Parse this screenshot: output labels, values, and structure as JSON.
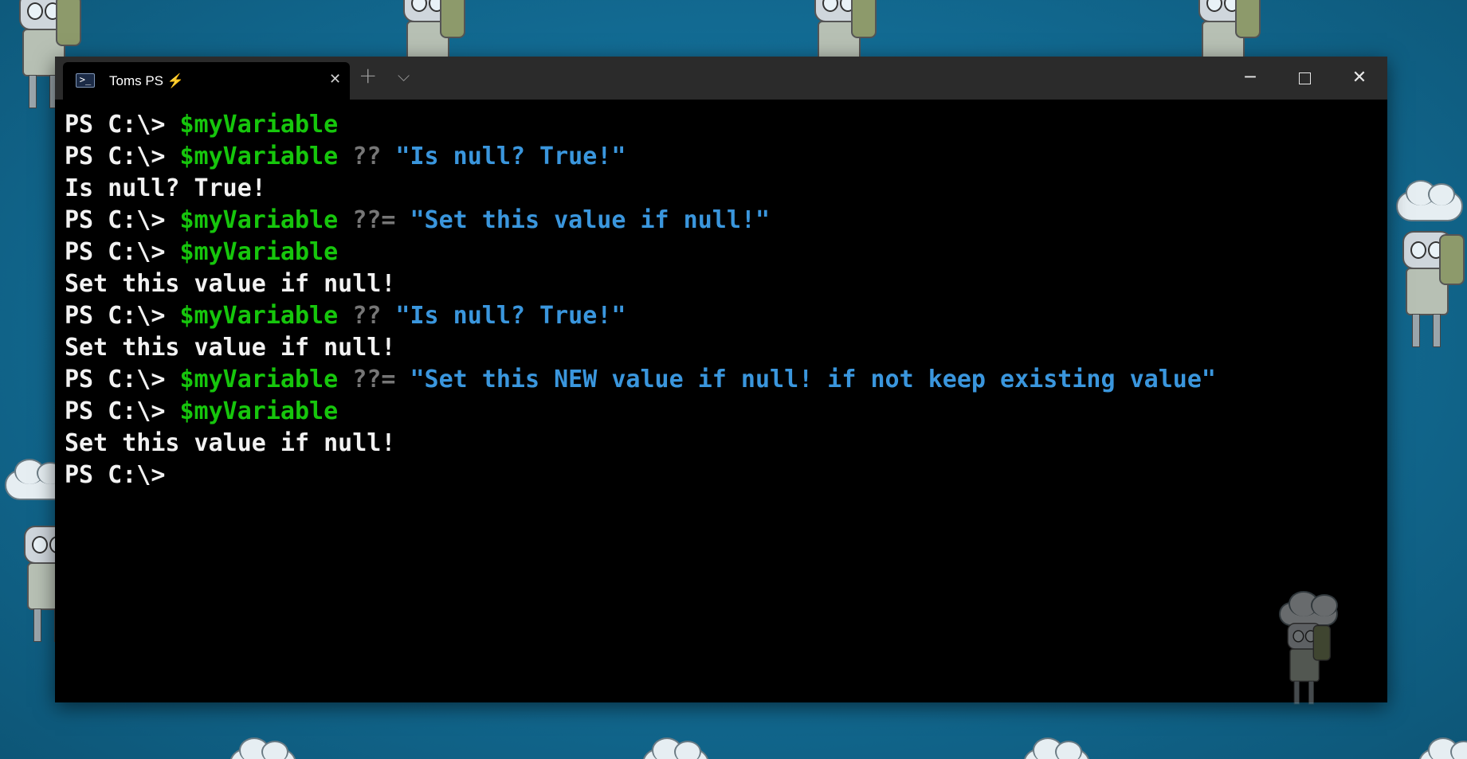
{
  "tab": {
    "icon": "powershell-icon",
    "title": "Toms PS ⚡",
    "close_glyph": "✕"
  },
  "titlebar": {
    "new_tab_glyph": "+",
    "dropdown_glyph": "⌵",
    "minimize_glyph": "─",
    "close_glyph": "✕"
  },
  "console": {
    "prompt": "PS C:\\> ",
    "lines": [
      {
        "type": "cmd",
        "var": "$myVariable",
        "op": "",
        "str": ""
      },
      {
        "type": "cmd",
        "var": "$myVariable",
        "op": " ??",
        "str": " \"Is null? True!\""
      },
      {
        "type": "out",
        "text": "Is null? True!"
      },
      {
        "type": "cmd",
        "var": "$myVariable",
        "op": " ??=",
        "str": " \"Set this value if null!\""
      },
      {
        "type": "cmd",
        "var": "$myVariable",
        "op": "",
        "str": ""
      },
      {
        "type": "out",
        "text": "Set this value if null!"
      },
      {
        "type": "cmd",
        "var": "$myVariable",
        "op": " ??",
        "str": " \"Is null? True!\""
      },
      {
        "type": "out",
        "text": "Set this value if null!"
      },
      {
        "type": "cmd",
        "var": "$myVariable",
        "op": " ??=",
        "str": " \"Set this NEW value if null! if not keep existing value\""
      },
      {
        "type": "cmd",
        "var": "$myVariable",
        "op": "",
        "str": ""
      },
      {
        "type": "out",
        "text": "Set this value if null!"
      },
      {
        "type": "prompt"
      }
    ]
  },
  "colors": {
    "background": "#0c0c0c",
    "variable": "#16c60c",
    "operator": "#767676",
    "string": "#3a96dd",
    "text": "#f2f2f2",
    "titlebar": "#2b2b2b",
    "desktop": "#136e97"
  }
}
